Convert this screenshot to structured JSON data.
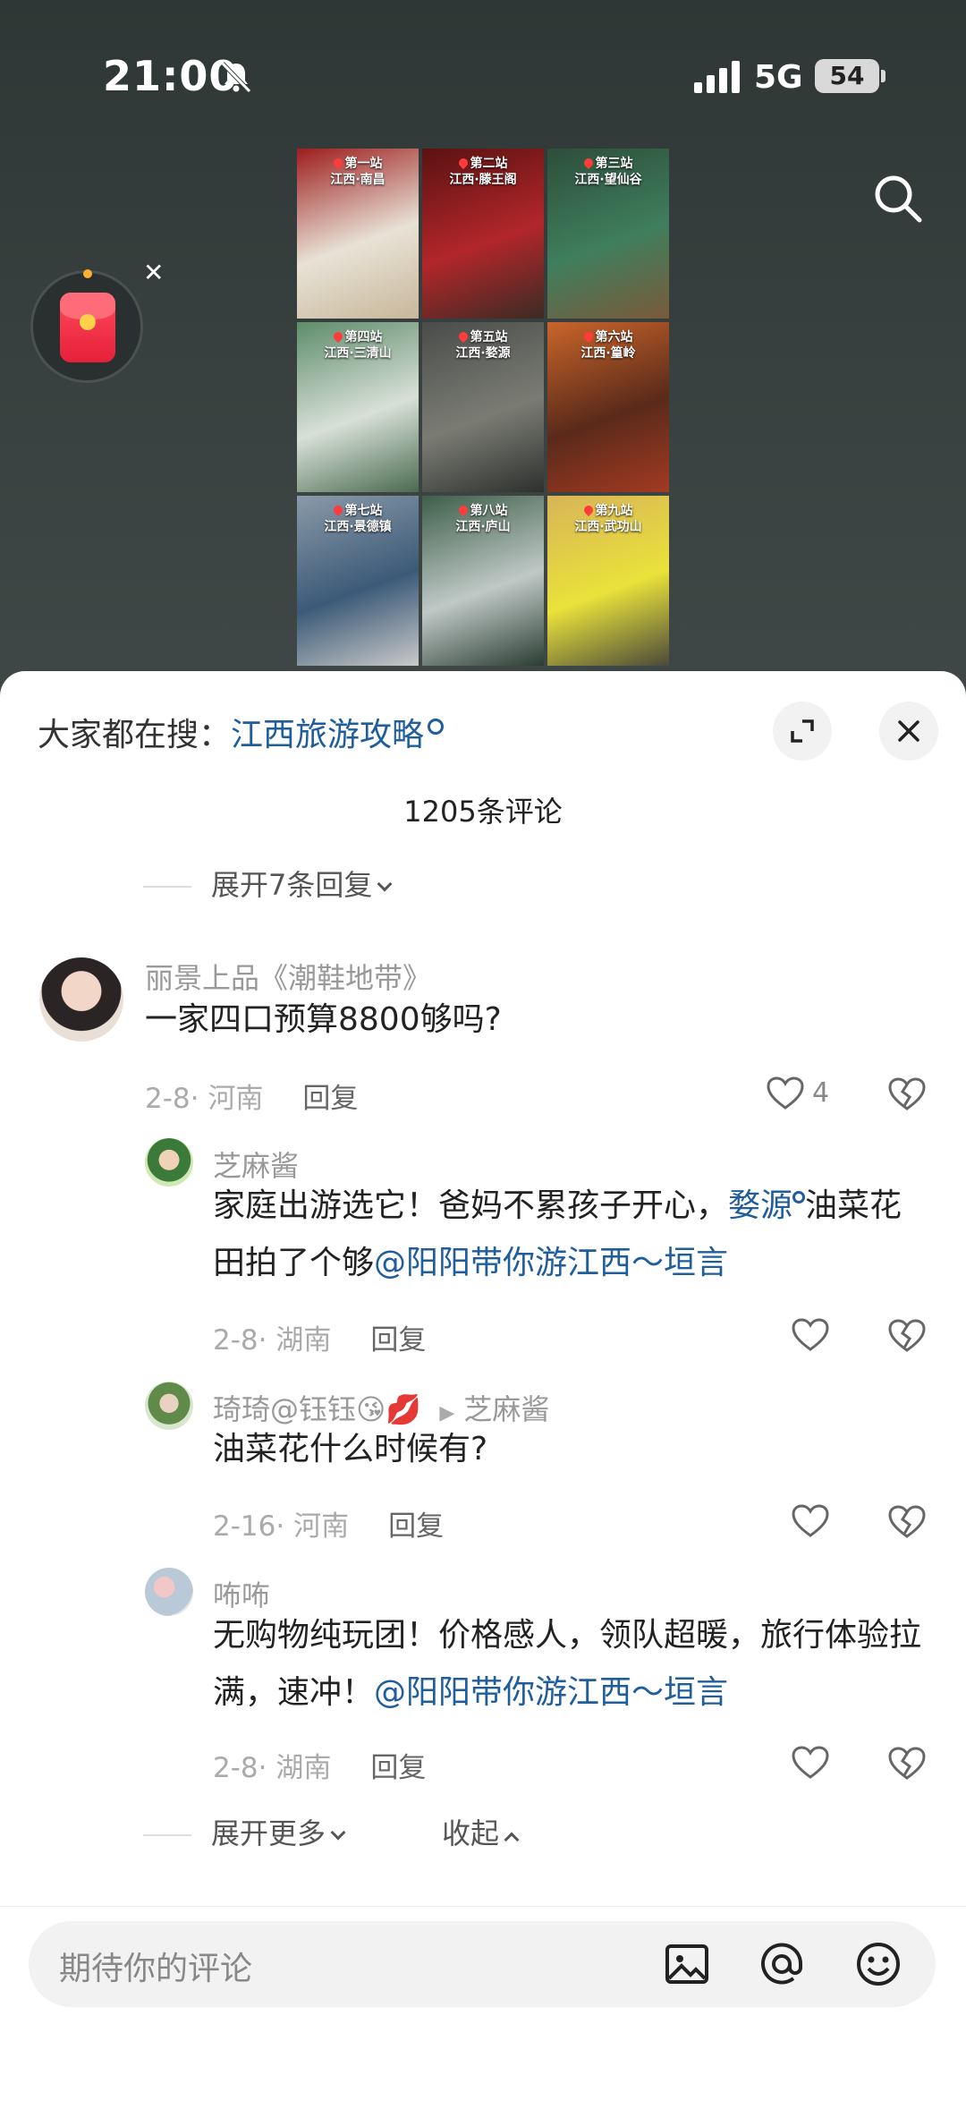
{
  "status": {
    "time": "21:00",
    "network": "5G",
    "battery": "54"
  },
  "video": {
    "tiles": [
      {
        "caption_line1": "第一站",
        "caption_line2": "江西·南昌",
        "colors": [
          "#9d1d1d",
          "#e8e2d6",
          "#c8b79a"
        ]
      },
      {
        "caption_line1": "第二站",
        "caption_line2": "江西·滕王阁",
        "colors": [
          "#5a1212",
          "#b2262a",
          "#3b2b24"
        ]
      },
      {
        "caption_line1": "第三站",
        "caption_line2": "江西·望仙谷",
        "colors": [
          "#2d4e3a",
          "#3f7e5d",
          "#7a5a3a"
        ]
      },
      {
        "caption_line1": "第四站",
        "caption_line2": "江西·三清山",
        "colors": [
          "#5e8c6a",
          "#d8e0d8",
          "#4a6b4f"
        ]
      },
      {
        "caption_line1": "第五站",
        "caption_line2": "江西·婺源",
        "colors": [
          "#4a4c4a",
          "#7a7c74",
          "#2e302e"
        ]
      },
      {
        "caption_line1": "第六站",
        "caption_line2": "江西·篁岭",
        "colors": [
          "#c9652a",
          "#5a2a1a",
          "#a33a22"
        ]
      },
      {
        "caption_line1": "第七站",
        "caption_line2": "江西·景德镇",
        "colors": [
          "#8a9aa8",
          "#3c5a78",
          "#c9c9c9"
        ]
      },
      {
        "caption_line1": "第八站",
        "caption_line2": "江西·庐山",
        "colors": [
          "#3e5e4a",
          "#bfc9c6",
          "#2b3d33"
        ]
      },
      {
        "caption_line1": "第九站",
        "caption_line2": "江西·武功山",
        "colors": [
          "#d8b458",
          "#e9e23a",
          "#4a4a3a"
        ]
      }
    ]
  },
  "panel": {
    "hot_search_prefix": "大家都在搜：",
    "hot_search_keyword": "江西旅游攻略",
    "comment_count": "1205条评论",
    "expand_prev": "展开7条回复",
    "expand_more": "展开更多",
    "collapse": "收起"
  },
  "comments": [
    {
      "user": "丽景上品《潮鞋地带》",
      "text": "一家四口预算8800够吗?",
      "date": "2-8",
      "location": "河南",
      "reply": "回复",
      "likes": "4"
    }
  ],
  "replies": [
    {
      "user": "芝麻酱",
      "text_a": "家庭出游选它！爸妈不累孩子开心，",
      "keyword": "婺源",
      "text_b": "油菜花田拍了个够",
      "mention": "@阳阳带你游江西～垣言",
      "date": "2-8",
      "location": "湖南",
      "reply": "回复"
    },
    {
      "user": "琦琦@钰钰",
      "emoji": "😘💋",
      "reply_to": "芝麻酱",
      "text": "油菜花什么时候有?",
      "date": "2-16",
      "location": "河南",
      "reply": "回复"
    },
    {
      "user": "咘咘",
      "text_a": "无购物纯玩团！价格感人，领队超暖，旅行体验拉满，速冲！",
      "mention": "@阳阳带你游江西～垣言",
      "date": "2-8",
      "location": "湖南",
      "reply": "回复"
    }
  ],
  "composer": {
    "placeholder": "期待你的评论"
  },
  "icons": {
    "search": "search-icon",
    "bell_off": "bell-off-icon",
    "expand": "expand-icon",
    "close": "close-icon",
    "like": "heart-icon",
    "dislike": "broken-heart-icon",
    "image": "image-icon",
    "at": "at-icon",
    "emoji": "emoji-icon"
  }
}
